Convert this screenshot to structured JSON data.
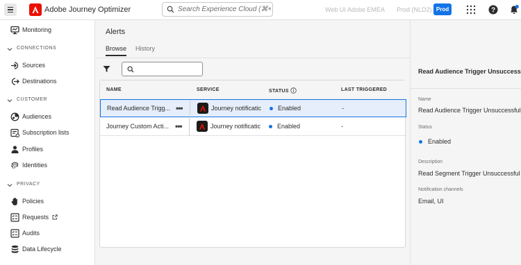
{
  "header": {
    "app_name": "Adobe Journey Optimizer",
    "search_placeholder": "Search Experience Cloud (⌘+/)",
    "org_name": "Web UI Adobe EMEA",
    "sandbox_name": "Prod (NLD2)",
    "env_badge": "Prod"
  },
  "sidebar": {
    "monitoring": "Monitoring",
    "sections": {
      "connections": "CONNECTIONS",
      "customer": "CUSTOMER",
      "privacy": "PRIVACY"
    },
    "items": {
      "sources": "Sources",
      "destinations": "Destinations",
      "audiences": "Audiences",
      "subscription_lists": "Subscription lists",
      "profiles": "Profiles",
      "identities": "Identities",
      "policies": "Policies",
      "requests": "Requests",
      "audits": "Audits",
      "data_lifecycle": "Data Lifecycle"
    }
  },
  "main": {
    "title": "Alerts",
    "tabs": [
      "Browse",
      "History"
    ],
    "columns": {
      "name": "NAME",
      "service": "SERVICE",
      "status": "STATUS",
      "last_triggered": "LAST TRIGGERED"
    },
    "rows": [
      {
        "name": "Read Audience Trigg...",
        "service": "Journey notificatic",
        "status": "Enabled",
        "last_triggered": "-"
      },
      {
        "name": "Journey Custom Acti...",
        "service": "Journey notificatic",
        "status": "Enabled",
        "last_triggered": "-"
      }
    ],
    "more_glyph": "•••"
  },
  "details": {
    "title": "Read Audience Trigger Unsuccessful",
    "name_label": "Name",
    "name_value": "Read Audience Trigger Unsuccessful",
    "status_label": "Status",
    "status_value": "Enabled",
    "description_label": "Description",
    "description_value": "Read Segment Trigger Unsuccessful",
    "channels_label": "Notification channels",
    "channels_value": "Email, UI"
  },
  "colors": {
    "accent": "#1473e6",
    "brand": "#eb1000",
    "selected_row": "#e5eefa"
  },
  "icons": [
    "menu-icon",
    "adobe-logo-icon",
    "search-icon",
    "apps-grid-icon",
    "help-icon",
    "bell-icon",
    "filter-icon",
    "info-icon",
    "external-link-icon"
  ]
}
